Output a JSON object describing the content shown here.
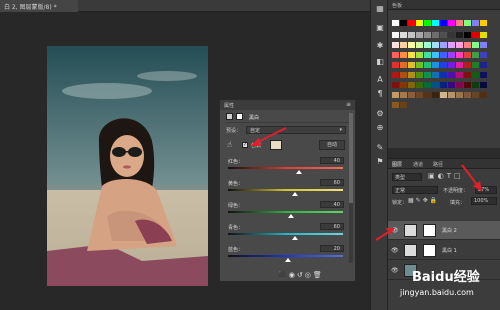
{
  "document_tab": {
    "title": "白 2, 图层蒙版/8) *"
  },
  "properties_panel": {
    "header": "属性",
    "title": "黑白",
    "preset_label": "预设：",
    "preset_value": "自定",
    "tint_label": "色调",
    "auto_button": "自动",
    "sliders": [
      {
        "label": "红色：",
        "value": "40",
        "colors": [
          "#e23b2b",
          "#f06d5d"
        ],
        "position": 0.62
      },
      {
        "label": "黄色：",
        "value": "60",
        "colors": [
          "#d8c12a",
          "#eee27a"
        ],
        "position": 0.58
      },
      {
        "label": "绿色：",
        "value": "40",
        "colors": [
          "#2fb13b",
          "#5fd36a"
        ],
        "position": 0.55
      },
      {
        "label": "青色：",
        "value": "60",
        "colors": [
          "#1fb6c7",
          "#6ad5e0"
        ],
        "position": 0.58
      },
      {
        "label": "蓝色：",
        "value": "20",
        "colors": [
          "#2233c8",
          "#5a6ae0"
        ],
        "position": 0.52
      }
    ]
  },
  "swatches_panel": {
    "tab_label": "色板"
  },
  "layers_panel": {
    "tabs": [
      "图层",
      "通道",
      "路径"
    ],
    "kind_filter": "类型",
    "blend_mode": "正常",
    "opacity_label": "不透明度：",
    "opacity_value": "27%",
    "lock_label": "锁定：",
    "fill_label": "填充：",
    "fill_value": "100%",
    "layers": [
      {
        "name": "黑白 2"
      },
      {
        "name": "黑白 1"
      }
    ]
  },
  "watermark": {
    "brand": "Baidu经验",
    "url": "jingyan.baidu.com"
  },
  "colors": {
    "panel_bg": "#494949",
    "canvas_bg": "#282828",
    "annotation_arrow": "#e0202a",
    "accent_swatch": "#e6dcc6"
  }
}
